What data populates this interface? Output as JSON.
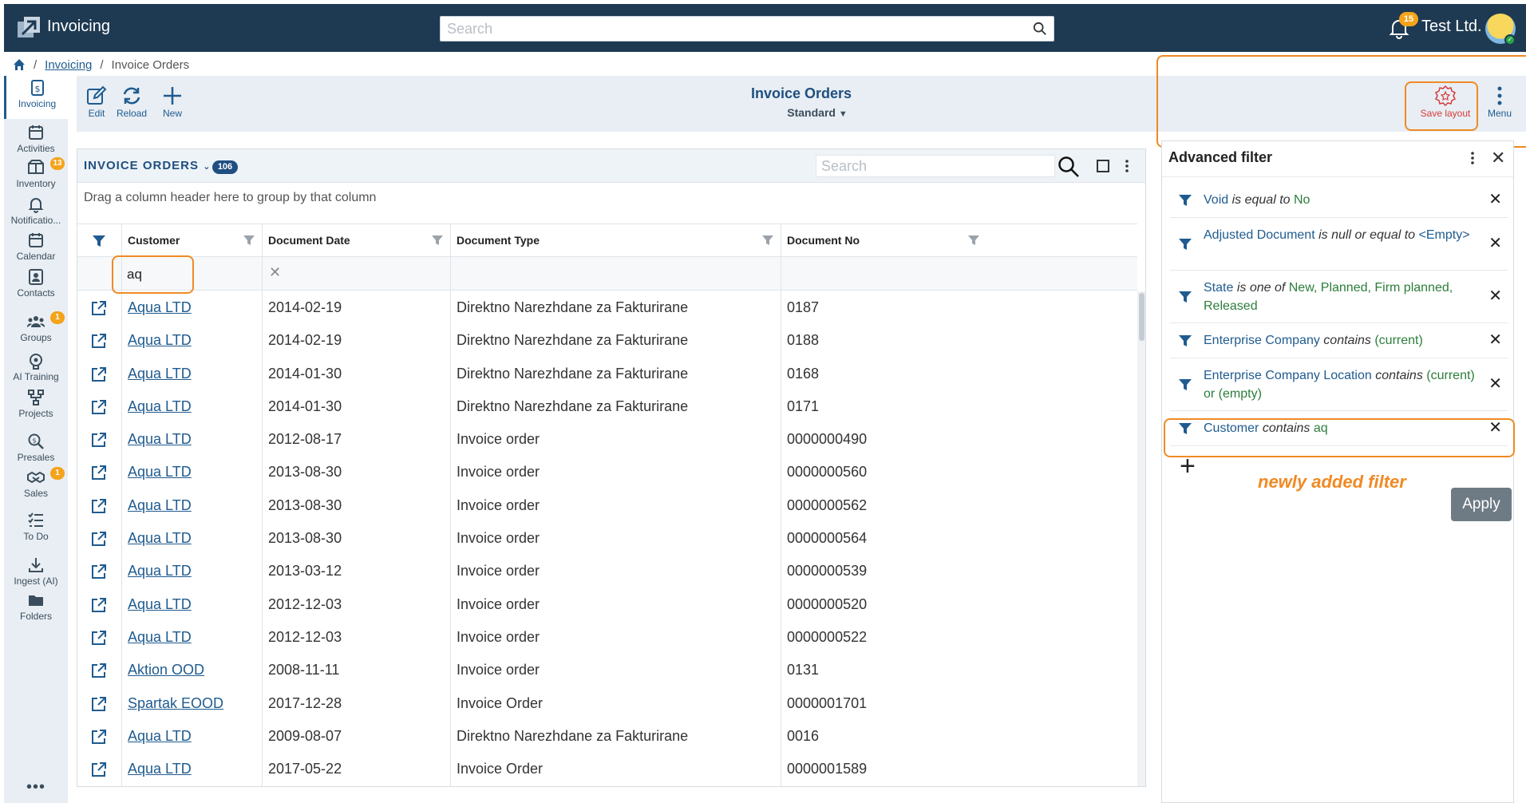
{
  "app": {
    "title": "Invoicing",
    "search_placeholder": "Search",
    "notification_count": "15",
    "company": "Test Ltd."
  },
  "breadcrumb": {
    "link": "Invoicing",
    "sep1": "/",
    "sep2": "/",
    "current": "Invoice Orders"
  },
  "nav": {
    "items": [
      {
        "label": "Invoicing"
      },
      {
        "label": "Activities"
      },
      {
        "label": "Inventory",
        "badge": "13"
      },
      {
        "label": "Notificatio..."
      },
      {
        "label": "Calendar"
      },
      {
        "label": "Contacts"
      },
      {
        "label": "Groups",
        "badge": "1"
      },
      {
        "label": "AI Training"
      },
      {
        "label": "Projects"
      },
      {
        "label": "Presales"
      },
      {
        "label": "Sales",
        "badge": "1"
      },
      {
        "label": "To Do"
      },
      {
        "label": "Ingest (AI)"
      },
      {
        "label": "Folders"
      }
    ],
    "more": "•••"
  },
  "toolbar": {
    "edit": "Edit",
    "reload": "Reload",
    "new": "New",
    "title": "Invoice Orders",
    "view": "Standard",
    "save_layout": "Save layout",
    "menu": "Menu"
  },
  "grid": {
    "title": "INVOICE ORDERS",
    "count": "106",
    "search_placeholder": "Search",
    "group_hint": "Drag a column header here to group by that column",
    "columns": [
      "Customer",
      "Document Date",
      "Document Type",
      "Document No"
    ],
    "customer_filter": "aq",
    "rows": [
      {
        "customer": "Aqua LTD",
        "date": "2014-02-19",
        "type": "Direktno Narezhdane za Fakturirane",
        "no": "0187"
      },
      {
        "customer": "Aqua LTD",
        "date": "2014-02-19",
        "type": "Direktno Narezhdane za Fakturirane",
        "no": "0188"
      },
      {
        "customer": "Aqua LTD",
        "date": "2014-01-30",
        "type": "Direktno Narezhdane za Fakturirane",
        "no": "0168"
      },
      {
        "customer": "Aqua LTD",
        "date": "2014-01-30",
        "type": "Direktno Narezhdane za Fakturirane",
        "no": "0171"
      },
      {
        "customer": "Aqua LTD",
        "date": "2012-08-17",
        "type": "Invoice order",
        "no": "0000000490"
      },
      {
        "customer": "Aqua LTD",
        "date": "2013-08-30",
        "type": "Invoice order",
        "no": "0000000560"
      },
      {
        "customer": "Aqua LTD",
        "date": "2013-08-30",
        "type": "Invoice order",
        "no": "0000000562"
      },
      {
        "customer": "Aqua LTD",
        "date": "2013-08-30",
        "type": "Invoice order",
        "no": "0000000564"
      },
      {
        "customer": "Aqua LTD",
        "date": "2013-03-12",
        "type": "Invoice order",
        "no": "0000000539"
      },
      {
        "customer": "Aqua LTD",
        "date": "2012-12-03",
        "type": "Invoice order",
        "no": "0000000520"
      },
      {
        "customer": "Aqua LTD",
        "date": "2012-12-03",
        "type": "Invoice order",
        "no": "0000000522"
      },
      {
        "customer": "Aktion OOD",
        "date": "2008-11-11",
        "type": "Invoice order",
        "no": "0131"
      },
      {
        "customer": "Spartak EOOD",
        "date": "2017-12-28",
        "type": "Invoice Order",
        "no": "0000001701"
      },
      {
        "customer": "Aqua LTD",
        "date": "2009-08-07",
        "type": "Direktno Narezhdane za Fakturirane",
        "no": "0016"
      },
      {
        "customer": "Aqua LTD",
        "date": "2017-05-22",
        "type": "Invoice Order",
        "no": "0000001589"
      }
    ]
  },
  "filter_panel": {
    "title": "Advanced filter",
    "filters": [
      {
        "field": "Void",
        "op": "is equal to",
        "value": "No"
      },
      {
        "field": "Adjusted Document",
        "op": "is null or equal to",
        "value": "<Empty>"
      },
      {
        "field": "State",
        "op": "is one of",
        "value": "New, Planned, Firm planned, Released"
      },
      {
        "field": "Enterprise Company",
        "op": "contains",
        "value": "(current)"
      },
      {
        "field": "Enterprise Company Location",
        "op": "contains",
        "value": "(current) or (empty)"
      },
      {
        "field": "Customer",
        "op": "contains",
        "value": "aq"
      }
    ],
    "add": "+",
    "note": "newly added filter",
    "apply": "Apply"
  },
  "colors": {
    "topbar": "#1e3a52",
    "accent": "#1f5b8f",
    "highlight": "#f08a24",
    "badge": "#f5a31a",
    "value": "#2c7d3b"
  }
}
